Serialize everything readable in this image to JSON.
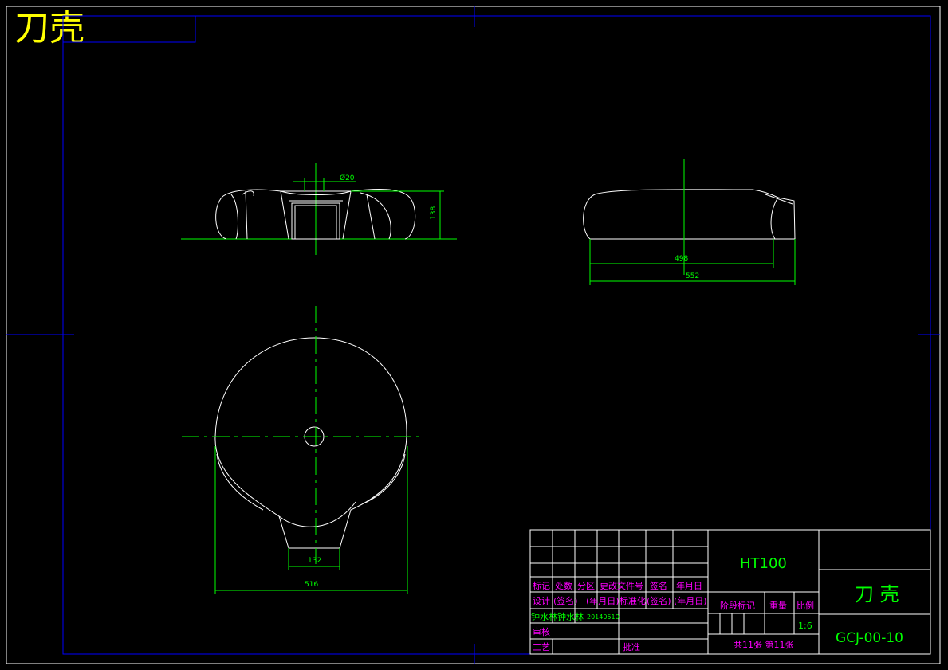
{
  "corner_title": "刀壳",
  "dimensions": {
    "diameter_hole": "Ø20",
    "height": "138",
    "inner_width": "498",
    "outer_width": "552",
    "mouth_width": "132",
    "body_width": "516"
  },
  "title_block": {
    "material": "HT100",
    "part_name": "刀 壳",
    "drawing_number": "GCJ-00-10",
    "headers": {
      "mark": "标记",
      "count": "处数",
      "zone": "分区",
      "change_doc": "更改文件号",
      "signature": "签名",
      "date": "年月日"
    },
    "design": "设计",
    "sig_paren": "(签名)",
    "date_paren": "(年月日)",
    "standardization": "标准化",
    "sig_paren2": "(签名)",
    "date_paren2": "(年月日)",
    "designer_name": "钟水林",
    "designer_name2": "钟水林",
    "design_date": "20140510",
    "review": "审核",
    "process": "工艺",
    "approve": "批准",
    "stage_mark": "阶段标记",
    "weight": "重量",
    "scale_label": "比例",
    "scale_value": "1:6",
    "sheets": "共11张  第11张"
  }
}
